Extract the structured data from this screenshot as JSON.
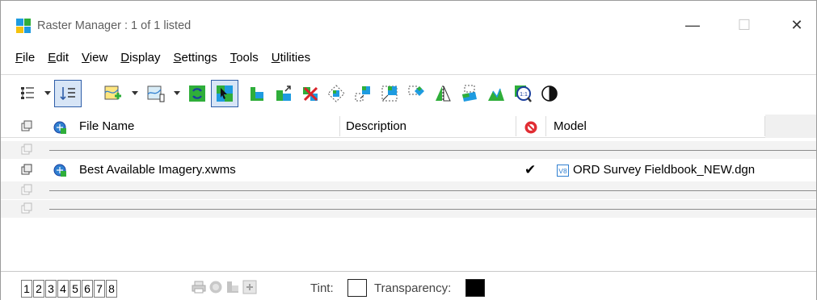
{
  "window": {
    "title": "Raster Manager : 1 of 1 listed",
    "minimize": "—",
    "maximize": "☐",
    "close": "✕"
  },
  "menu": [
    {
      "ul": "F",
      "rest": "ile"
    },
    {
      "ul": "E",
      "rest": "dit"
    },
    {
      "ul": "V",
      "rest": "iew"
    },
    {
      "ul": "D",
      "rest": "isplay"
    },
    {
      "ul": "S",
      "rest": "ettings"
    },
    {
      "ul": "T",
      "rest": "ools"
    },
    {
      "ul": "U",
      "rest": "tilities"
    }
  ],
  "columns": {
    "file_name": "File Name",
    "description": "Description",
    "model": "Model"
  },
  "rows": [
    {
      "file_name": "",
      "description": "",
      "check": "",
      "model": ""
    },
    {
      "file_name": "Best Available Imagery.xwms",
      "description": "",
      "check": "✔",
      "model": "ORD Survey Fieldbook_NEW.dgn"
    },
    {
      "file_name": "",
      "description": "",
      "check": "",
      "model": ""
    },
    {
      "file_name": "",
      "description": "",
      "check": "",
      "model": ""
    }
  ],
  "status": {
    "views": [
      "1",
      "2",
      "3",
      "4",
      "5",
      "6",
      "7",
      "8"
    ],
    "tint_label": "Tint:",
    "transparency_label": "Transparency:",
    "tint_color": "#ffffff",
    "transparency_color": "#000000"
  },
  "colors": {
    "accent": "#2f5ea8",
    "selection": "#d7e5f6"
  }
}
